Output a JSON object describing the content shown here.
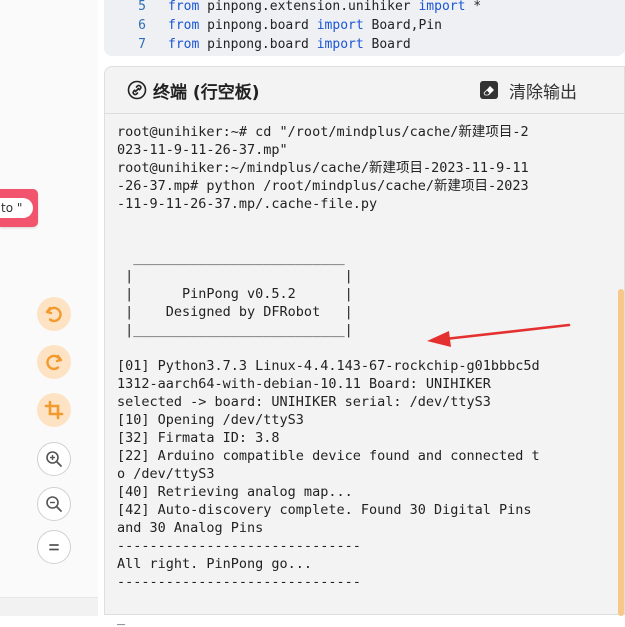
{
  "code": {
    "lines": [
      {
        "num": "5",
        "from": "from",
        "module": "pinpong.extension.unihiker",
        "import": "import",
        "target": "*"
      },
      {
        "num": "6",
        "from": "from",
        "module": "pinpong.board",
        "import": "import",
        "target": "Board,Pin"
      },
      {
        "num": "7",
        "from": "from",
        "module": "pinpong.board",
        "import": "import",
        "target": "Board"
      }
    ]
  },
  "canvas": {
    "block_text": "to \""
  },
  "tools": [
    "undo-icon",
    "redo-icon",
    "crop-icon",
    "zoom-in-icon",
    "zoom-out-icon",
    "reset-zoom-icon"
  ],
  "terminal": {
    "title": "终端 (行空板)",
    "clear_label": "清除输出",
    "lines": [
      "root@unihiker:~# cd \"/root/mindplus/cache/新建项目-2",
      "023-11-9-11-26-37.mp\"",
      "root@unihiker:~/mindplus/cache/新建项目-2023-11-9-11",
      "-26-37.mp# python /root/mindplus/cache/新建项目-2023",
      "-11-9-11-26-37.mp/.cache-file.py",
      "",
      "",
      "  __________________________",
      " |                          |",
      " |      PinPong v0.5.2      |",
      " |    Designed by DFRobot   |",
      " |__________________________|",
      "",
      "[01] Python3.7.3 Linux-4.4.143-67-rockchip-g01bbbc5d",
      "1312-aarch64-with-debian-10.11 Board: UNIHIKER",
      "selected -> board: UNIHIKER serial: /dev/ttyS3",
      "[10] Opening /dev/ttyS3",
      "[32] Firmata ID: 3.8",
      "[22] Arduino compatible device found and connected t",
      "o /dev/ttyS3",
      "[40] Retrieving analog map...",
      "[42] Auto-discovery complete. Found 30 Digital Pins",
      "and 30 Analog Pins",
      "------------------------------",
      "All right. PinPong go...",
      "------------------------------",
      "",
      "_"
    ]
  },
  "colors": {
    "accent": "#f2546e",
    "tool_orange": "#fde3c3",
    "tool_icon": "#f29a2e",
    "keyword": "#1a55d6",
    "arrow": "#e53030"
  }
}
